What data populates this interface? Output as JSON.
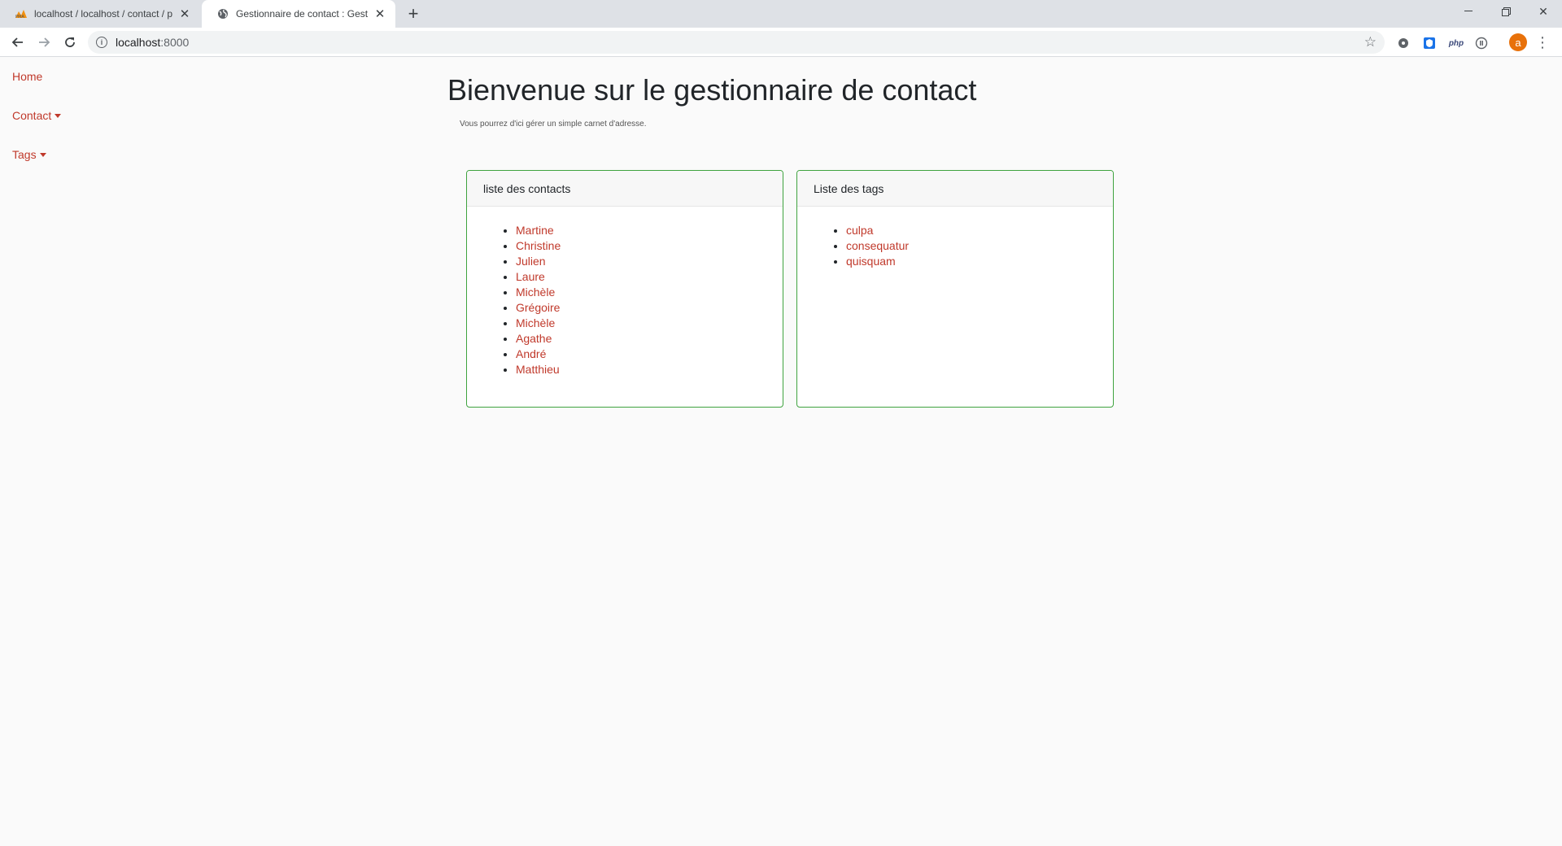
{
  "browser": {
    "tabs": [
      {
        "title": "localhost / localhost / contact / p",
        "active": false,
        "favicon": "phpmyadmin-icon"
      },
      {
        "title": "Gestionnaire de contact : Gestion",
        "active": true,
        "favicon": "globe-icon"
      }
    ],
    "address": {
      "host": "localhost",
      "port": ":8000"
    },
    "profile_initial": "a"
  },
  "sidebar": {
    "items": [
      {
        "label": "Home",
        "dropdown": false
      },
      {
        "label": "Contact",
        "dropdown": true
      },
      {
        "label": "Tags",
        "dropdown": true
      }
    ]
  },
  "hero": {
    "title": "Bienvenue sur le gestionnaire de contact",
    "subtitle": "Vous pourrez d'ici gérer un simple carnet d'adresse."
  },
  "contacts_card": {
    "header": "liste des contacts",
    "items": [
      "Martine",
      "Christine",
      "Julien",
      "Laure",
      "Michèle",
      "Grégoire",
      "Michèle",
      "Agathe",
      "André",
      "Matthieu"
    ]
  },
  "tags_card": {
    "header": "Liste des tags",
    "items": [
      "culpa",
      "consequatur",
      "quisquam"
    ]
  },
  "colors": {
    "link": "#c0392b",
    "card_border": "#3fa33f",
    "background": "#fafafa"
  }
}
